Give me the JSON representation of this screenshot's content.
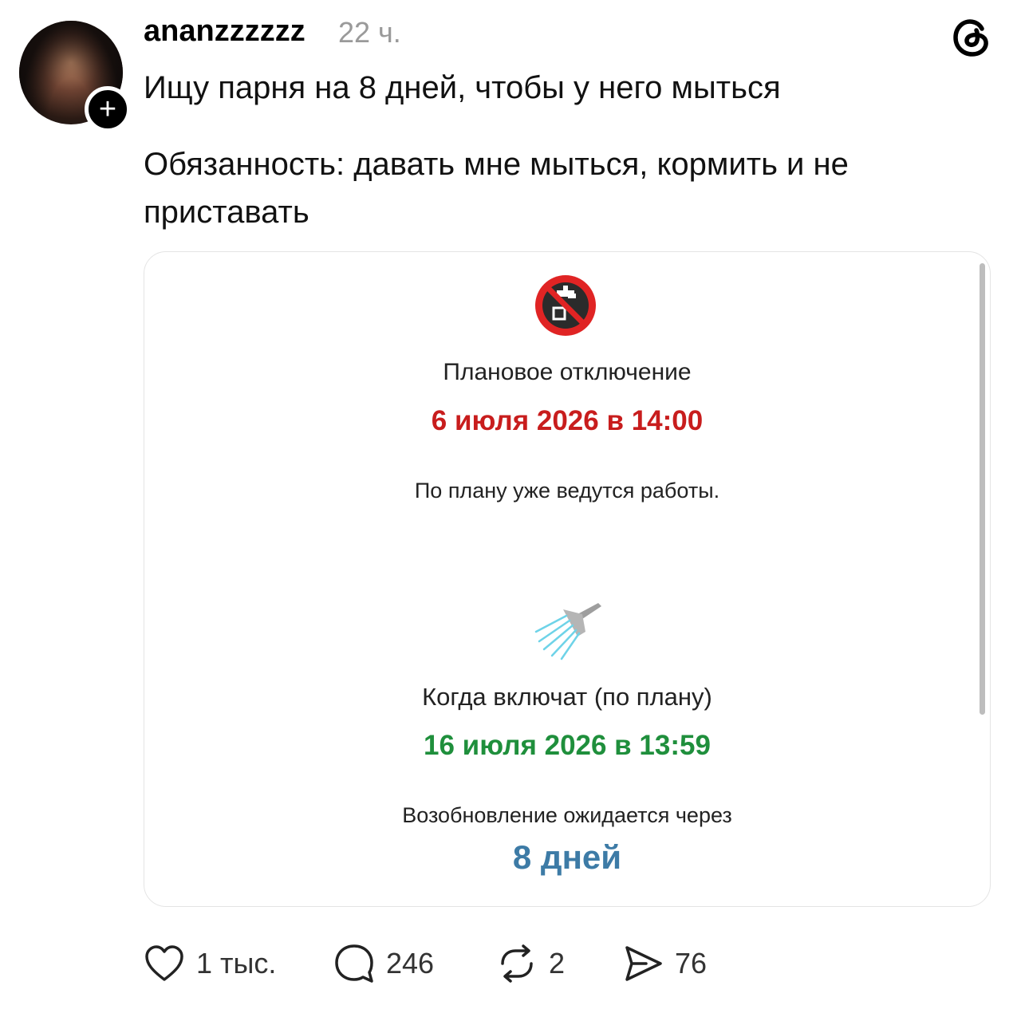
{
  "post": {
    "username": "ananzzzzzz",
    "time": "22 ч.",
    "line1": "Ищу парня на 8 дней, чтобы у него мыться",
    "line2": "Обязанность: давать мне мыться, кормить и не приставать"
  },
  "card": {
    "icon_top": "no-water-icon",
    "outage_label": "Плановое отключение",
    "outage_date": "6 июля 2026 в 14:00",
    "work_status": "По плану уже ведутся работы.",
    "icon_bottom": "shower-icon",
    "resume_label": "Когда включат (по плану)",
    "resume_date": "16 июля 2026 в 13:59",
    "countdown_label": "Возобновление ожидается через",
    "countdown_value": "8 дней",
    "colors": {
      "outage": "#c81d1d",
      "resume": "#1f8f3c",
      "countdown": "#3d7ba6"
    }
  },
  "actions": {
    "likes": "1 тыс.",
    "comments": "246",
    "reposts": "2",
    "shares": "76"
  }
}
